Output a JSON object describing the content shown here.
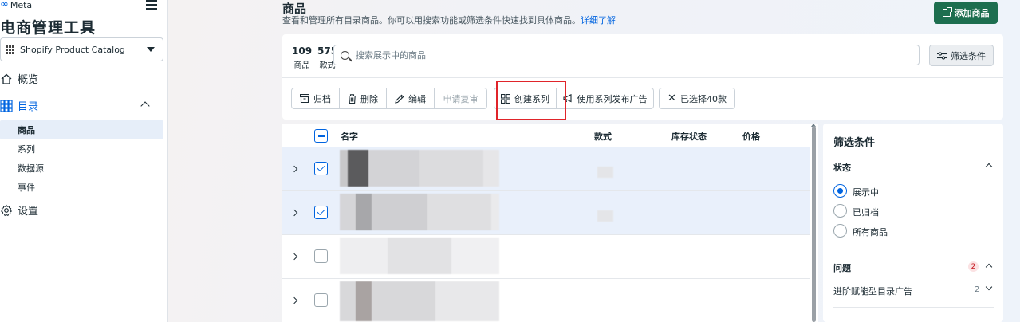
{
  "brand": {
    "logo_text": "Meta",
    "app_title": "电商管理工具"
  },
  "catalog_select": {
    "value": "Shopify Product Catalog"
  },
  "nav": {
    "overview": "概览",
    "catalog": "目录",
    "sub_items": [
      "商品",
      "系列",
      "数据源",
      "事件"
    ],
    "settings": "设置"
  },
  "header": {
    "title": "商品",
    "description": "查看和管理所有目录商品。你可以用搜索功能或筛选条件快速找到具体商品。",
    "learn_more": "详细了解",
    "add_button": "添加商品"
  },
  "stats": [
    {
      "value": "109",
      "label": "商品"
    },
    {
      "value": "575",
      "label": "款式"
    }
  ],
  "search": {
    "placeholder": "搜索展示中的商品"
  },
  "filter_button": "筛选条件",
  "toolbar": {
    "archive": "归档",
    "delete": "删除",
    "edit": "编辑",
    "request_review": "申请复审",
    "create_set": "创建系列",
    "advertise_set": "使用系列发布广告",
    "selected": "已选择40款"
  },
  "table": {
    "columns": [
      "名字",
      "款式",
      "库存状态",
      "价格"
    ],
    "rows": [
      {
        "checked": true
      },
      {
        "checked": true
      },
      {
        "checked": false
      },
      {
        "checked": false
      }
    ]
  },
  "filter_panel": {
    "title": "筛选条件",
    "status_section": "状态",
    "status_options": [
      "展示中",
      "已归档",
      "所有商品"
    ],
    "status_selected": "展示中",
    "issues_section": "问题",
    "issues_count": "2",
    "issue_item": "进阶赋能型目录广告",
    "issue_item_count": "2"
  }
}
